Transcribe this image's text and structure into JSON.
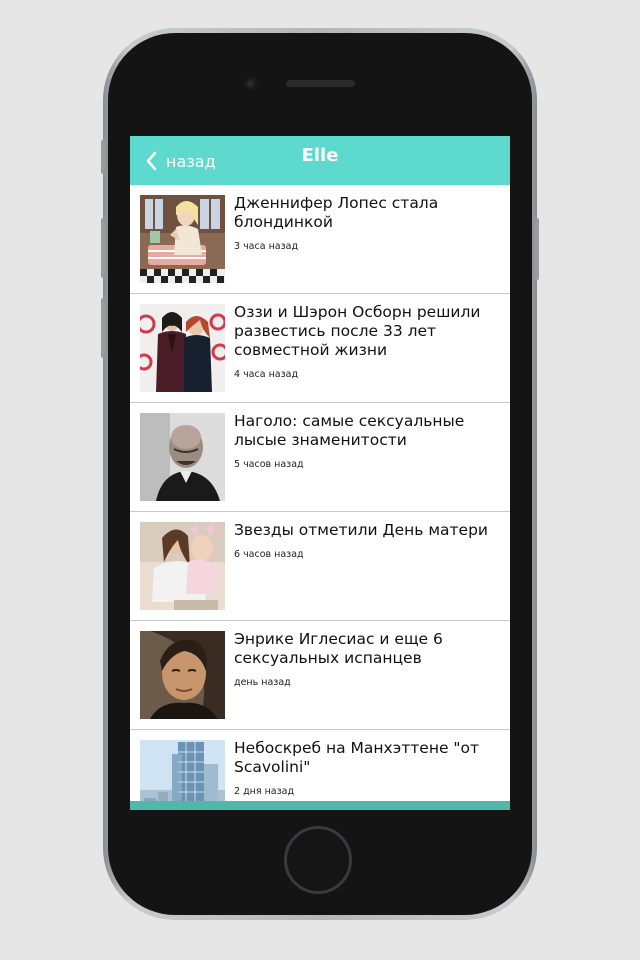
{
  "colors": {
    "navbar": "#5dd9cd",
    "bottom_bar": "#4fb8a8"
  },
  "navbar": {
    "back_icon": "chevron-left-icon",
    "back_label": "назад",
    "title": "Elle"
  },
  "articles": [
    {
      "title": "Дженнифер Лопес стала блондинкой",
      "time": "3 часа назад",
      "image": "jennifer-lopez-photo"
    },
    {
      "title": "Оззи и Шэрон Осборн решили развестись после 33 лет совместной жизни",
      "time": "4 часа назад",
      "image": "ozzy-sharon-photo"
    },
    {
      "title": "Наголо: самые сексуальные лысые знаменитости",
      "time": "5 часов назад",
      "image": "bald-celebrity-photo"
    },
    {
      "title": "Звезды отметили День матери",
      "time": "6 часов назад",
      "image": "mother-child-photo"
    },
    {
      "title": "Энрике Иглесиас и еще 6 сексуальных испанцев",
      "time": "день назад",
      "image": "enrique-iglesias-photo"
    },
    {
      "title": "Небоскреб на Манхэттене \"от Scavolini\"",
      "time": "2 дня назад",
      "image": "skyscraper-photo"
    }
  ]
}
